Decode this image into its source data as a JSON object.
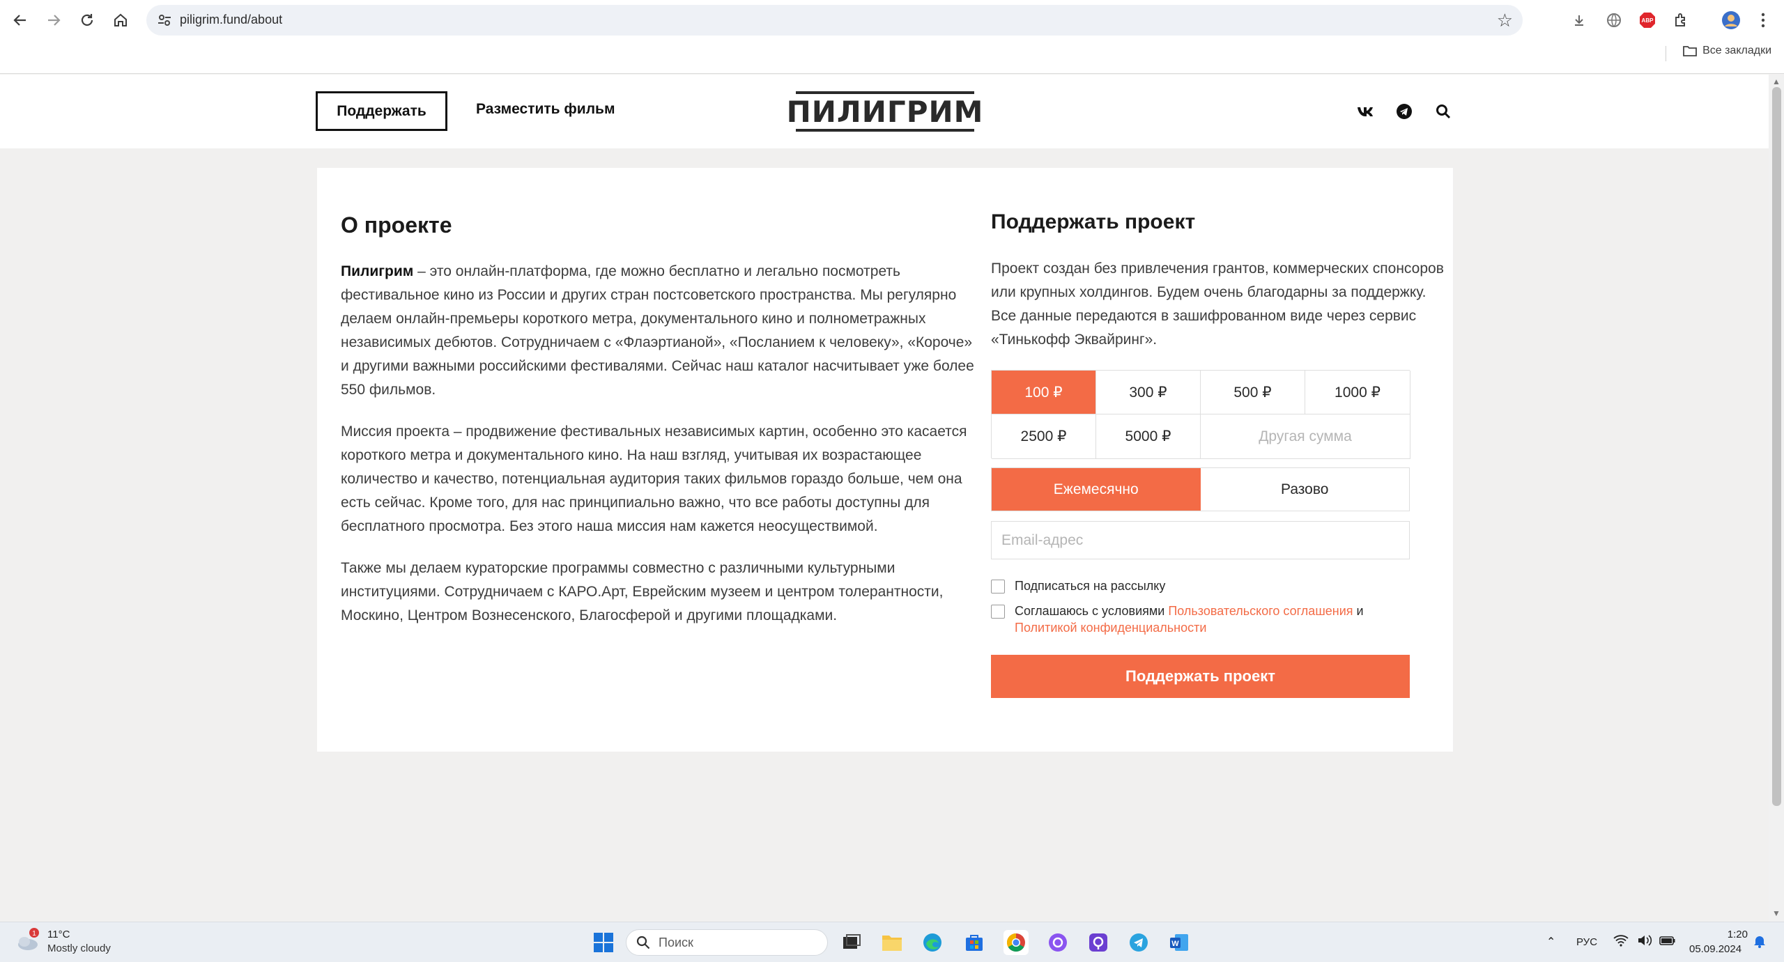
{
  "browser": {
    "url": "piligrim.fund/about",
    "bookmarks_label": "Все закладки"
  },
  "header": {
    "support_button": "Поддержать",
    "place_film_link": "Разместить фильм",
    "logo_text": "ПИЛИГРИМ"
  },
  "about": {
    "title": "О проекте",
    "p1_bold": "Пилигрим",
    "p1_rest": " – это онлайн-платформа, где можно бесплатно и легально посмотреть фестивальное кино из России и других стран постсоветского пространства. Мы регулярно делаем онлайн-премьеры короткого метра, документального кино и полнометражных независимых дебютов. Сотрудничаем с «Флаэртианой», «Посланием к человеку», «Короче» и другими важными российскими  фестивалями. Сейчас наш каталог насчитывает уже более 550 фильмов.",
    "p2": "Миссия проекта – продвижение фестивальных независимых картин, особенно это касается короткого метра и документального кино. На наш взгляд, учитывая их возрастающее количество и качество, потенциальная аудитория таких фильмов гораздо больше, чем она есть сейчас. Кроме того, для нас принципиально важно, что все работы доступны для бесплатного просмотра. Без этого наша миссия нам кажется неосуществимой.",
    "p3": "Также мы делаем кураторские программы совместно с различными культурными институциями. Сотрудничаем с КАРО.Арт, Еврейским музеем и центром толерантности, Москино, Центром Вознесенского, Благосферой и другими площадками."
  },
  "support": {
    "title": "Поддержать проект",
    "text": "Проект создан без привлечения грантов, коммерческих спонсоров или крупных холдингов. Будем очень благодарны за поддержку. Все данные передаются в зашифрованном виде через сервис «Тинькофф Эквайринг».",
    "amounts": [
      "100 ₽",
      "300 ₽",
      "500 ₽",
      "1000 ₽",
      "2500 ₽",
      "5000 ₽"
    ],
    "other_amount_placeholder": "Другая сумма",
    "selected_amount": "100 ₽",
    "freq_monthly": "Ежемесячно",
    "freq_once": "Разово",
    "email_placeholder": "Email-адрес",
    "subscribe_label": "Подписаться на рассылку",
    "agree_prefix": "Соглашаюсь с условиями ",
    "agree_link1": "Пользовательского соглашения",
    "agree_and": " и",
    "agree_link2": "Политикой конфиденциальности",
    "submit": "Поддержать проект",
    "accent_color": "#f36b46"
  },
  "taskbar": {
    "weather_temp": "11°C",
    "weather_desc": "Mostly cloudy",
    "weather_badge": "1",
    "search_placeholder": "Поиск",
    "lang": "РУС",
    "time": "1:20",
    "date": "05.09.2024"
  }
}
